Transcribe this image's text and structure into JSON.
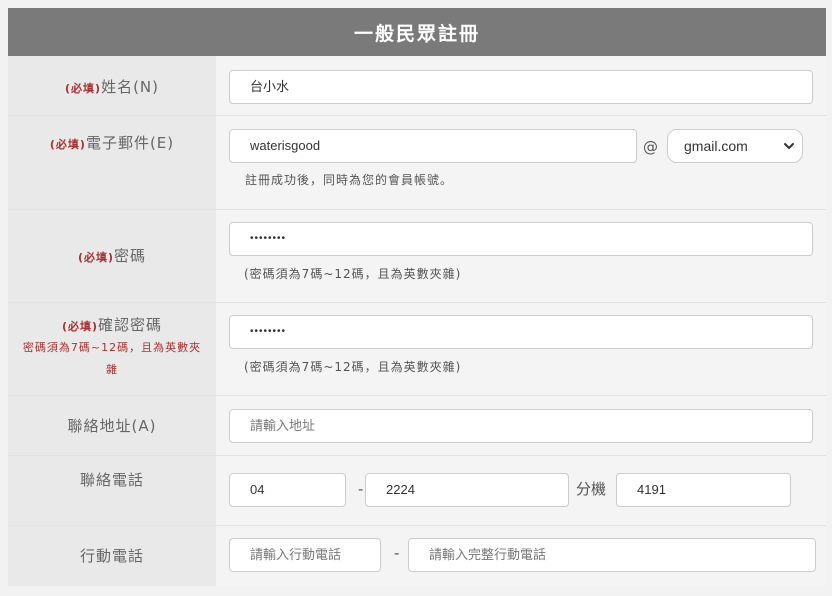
{
  "title": "一般民眾註冊",
  "required_tag": "(必填)",
  "name_row": {
    "label": "姓名(N)",
    "value": "台小水"
  },
  "email_row": {
    "label": "電子郵件(E)",
    "value": "waterisgood",
    "at": "@",
    "domain_selected": "gmail.com",
    "hint": "註冊成功後，同時為您的會員帳號。"
  },
  "password_row": {
    "label": "密碼",
    "value": "••••••••",
    "hint": "(密碼須為7碼~12碼，且為英數夾雜)"
  },
  "confirm_row": {
    "label": "確認密碼",
    "note": "密碼須為7碼~12碼，且為英數夾雜",
    "value": "••••••••",
    "hint": "(密碼須為7碼~12碼，且為英數夾雜)"
  },
  "address_row": {
    "label": "聯絡地址(A)",
    "placeholder": "請輸入地址"
  },
  "phone_row": {
    "label": "聯絡電話",
    "area_code": "04",
    "dash": "-",
    "number": "2224",
    "ext_label": "分機",
    "ext": "4191"
  },
  "mobile_row": {
    "label": "行動電話",
    "prefix_placeholder": "請輸入行動電話",
    "dash": "-",
    "number_placeholder": "請輸入完整行動電話"
  },
  "icons": {
    "select_arrow": "chevron-down-icon"
  }
}
